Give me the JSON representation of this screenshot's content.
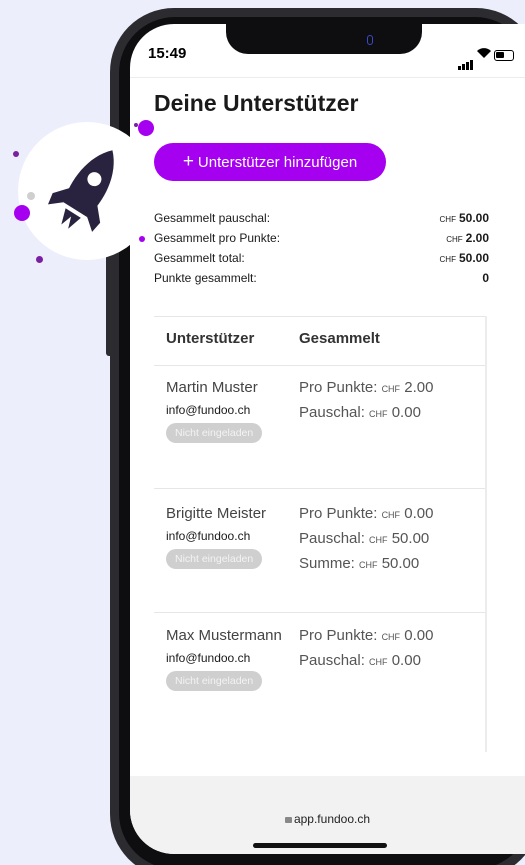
{
  "status_bar": {
    "time": "15:49"
  },
  "page": {
    "title": "Deine Unterstützer"
  },
  "add_button": {
    "icon": "plus-icon",
    "plus": "+",
    "label": "Unterstützer hinzufügen"
  },
  "summary": {
    "currency": "CHF",
    "rows": [
      {
        "label": "Gesammelt pauschal:",
        "value": "50.00"
      },
      {
        "label": "Gesammelt pro Punkte:",
        "value": "2.00"
      },
      {
        "label": "Gesammelt total:",
        "value": "50.00"
      },
      {
        "label": "Punkte gesammelt:",
        "value": "0"
      }
    ]
  },
  "table": {
    "columns": [
      "Unterstützer",
      "Gesammelt"
    ],
    "rows": [
      {
        "name": "Martin Muster",
        "email": "info@fundoo.ch",
        "badge": "Nicht eingeladen",
        "amounts": [
          {
            "label": "Pro Punkte:",
            "currency": "CHF",
            "value": "2.00"
          },
          {
            "label": "Pauschal:",
            "currency": "CHF",
            "value": "0.00"
          }
        ]
      },
      {
        "name": "Brigitte Meister",
        "email": "info@fundoo.ch",
        "badge": "Nicht eingeladen",
        "amounts": [
          {
            "label": "Pro Punkte:",
            "currency": "CHF",
            "value": "0.00"
          },
          {
            "label": "Pauschal:",
            "currency": "CHF",
            "value": "50.00"
          },
          {
            "label": "Summe:",
            "currency": "CHF",
            "value": "50.00"
          }
        ]
      },
      {
        "name": "Max Mustermann",
        "email": "info@fundoo.ch",
        "badge": "Nicht eingeladen",
        "amounts": [
          {
            "label": "Pro Punkte:",
            "currency": "CHF",
            "value": "0.00"
          },
          {
            "label": "Pauschal:",
            "currency": "CHF",
            "value": "0.00"
          }
        ]
      }
    ]
  },
  "browser": {
    "url": "app.fundoo.ch"
  },
  "colors": {
    "accent": "#a500f0",
    "background": "#eceefb",
    "rocket": "#2a2340",
    "dot": "#7b1fa2"
  },
  "decoration": {
    "icon": "rocket-icon"
  }
}
